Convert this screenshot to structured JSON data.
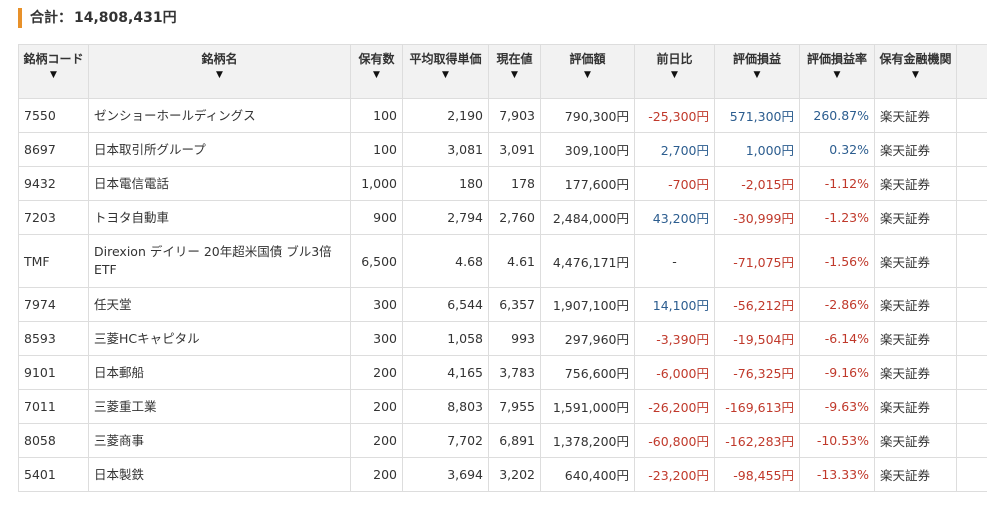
{
  "total": {
    "label": "合計：",
    "value": "14,808,431円"
  },
  "columns": [
    {
      "key": "code",
      "label": "銘柄コード"
    },
    {
      "key": "name",
      "label": "銘柄名"
    },
    {
      "key": "qty",
      "label": "保有数"
    },
    {
      "key": "avg",
      "label": "平均取得単価"
    },
    {
      "key": "price",
      "label": "現在値"
    },
    {
      "key": "value",
      "label": "評価額"
    },
    {
      "key": "change",
      "label": "前日比"
    },
    {
      "key": "pl",
      "label": "評価損益"
    },
    {
      "key": "plr",
      "label": "評価損益率"
    },
    {
      "key": "broker",
      "label": "保有金融機関"
    }
  ],
  "sort_glyph": "▼",
  "rows": [
    {
      "code": "7550",
      "name": "ゼンショーホールディングス",
      "qty": "100",
      "avg": "2,190",
      "price": "7,903",
      "value": "790,300円",
      "change": "-25,300円",
      "change_sign": "neg",
      "pl": "571,300円",
      "pl_sign": "pos",
      "plr": "260.87%",
      "plr_sign": "pos",
      "broker": "楽天証券"
    },
    {
      "code": "8697",
      "name": "日本取引所グループ",
      "qty": "100",
      "avg": "3,081",
      "price": "3,091",
      "value": "309,100円",
      "change": "2,700円",
      "change_sign": "pos",
      "pl": "1,000円",
      "pl_sign": "pos",
      "plr": "0.32%",
      "plr_sign": "pos",
      "broker": "楽天証券"
    },
    {
      "code": "9432",
      "name": "日本電信電話",
      "qty": "1,000",
      "avg": "180",
      "price": "178",
      "value": "177,600円",
      "change": "-700円",
      "change_sign": "neg",
      "pl": "-2,015円",
      "pl_sign": "neg",
      "plr": "-1.12%",
      "plr_sign": "neg",
      "broker": "楽天証券"
    },
    {
      "code": "7203",
      "name": "トヨタ自動車",
      "qty": "900",
      "avg": "2,794",
      "price": "2,760",
      "value": "2,484,000円",
      "change": "43,200円",
      "change_sign": "pos",
      "pl": "-30,999円",
      "pl_sign": "neg",
      "plr": "-1.23%",
      "plr_sign": "neg",
      "broker": "楽天証券"
    },
    {
      "code": "TMF",
      "name": "Direxion デイリー 20年超米国債 ブル3倍 ETF",
      "qty": "6,500",
      "avg": "4.68",
      "price": "4.61",
      "value": "4,476,171円",
      "change": "-",
      "change_sign": "none",
      "pl": "-71,075円",
      "pl_sign": "neg",
      "plr": "-1.56%",
      "plr_sign": "neg",
      "broker": "楽天証券",
      "tall": true
    },
    {
      "code": "7974",
      "name": "任天堂",
      "qty": "300",
      "avg": "6,544",
      "price": "6,357",
      "value": "1,907,100円",
      "change": "14,100円",
      "change_sign": "pos",
      "pl": "-56,212円",
      "pl_sign": "neg",
      "plr": "-2.86%",
      "plr_sign": "neg",
      "broker": "楽天証券"
    },
    {
      "code": "8593",
      "name": "三菱HCキャピタル",
      "qty": "300",
      "avg": "1,058",
      "price": "993",
      "value": "297,960円",
      "change": "-3,390円",
      "change_sign": "neg",
      "pl": "-19,504円",
      "pl_sign": "neg",
      "plr": "-6.14%",
      "plr_sign": "neg",
      "broker": "楽天証券"
    },
    {
      "code": "9101",
      "name": "日本郵船",
      "qty": "200",
      "avg": "4,165",
      "price": "3,783",
      "value": "756,600円",
      "change": "-6,000円",
      "change_sign": "neg",
      "pl": "-76,325円",
      "pl_sign": "neg",
      "plr": "-9.16%",
      "plr_sign": "neg",
      "broker": "楽天証券"
    },
    {
      "code": "7011",
      "name": "三菱重工業",
      "qty": "200",
      "avg": "8,803",
      "price": "7,955",
      "value": "1,591,000円",
      "change": "-26,200円",
      "change_sign": "neg",
      "pl": "-169,613円",
      "pl_sign": "neg",
      "plr": "-9.63%",
      "plr_sign": "neg",
      "broker": "楽天証券"
    },
    {
      "code": "8058",
      "name": "三菱商事",
      "qty": "200",
      "avg": "7,702",
      "price": "6,891",
      "value": "1,378,200円",
      "change": "-60,800円",
      "change_sign": "neg",
      "pl": "-162,283円",
      "pl_sign": "neg",
      "plr": "-10.53%",
      "plr_sign": "neg",
      "broker": "楽天証券"
    },
    {
      "code": "5401",
      "name": "日本製鉄",
      "qty": "200",
      "avg": "3,694",
      "price": "3,202",
      "value": "640,400円",
      "change": "-23,200円",
      "change_sign": "neg",
      "pl": "-98,455円",
      "pl_sign": "neg",
      "plr": "-13.33%",
      "plr_sign": "neg",
      "broker": "楽天証券"
    }
  ],
  "colors": {
    "accent": "#e8912a",
    "negative": "#c0392b",
    "positive": "#2c5d8f"
  }
}
